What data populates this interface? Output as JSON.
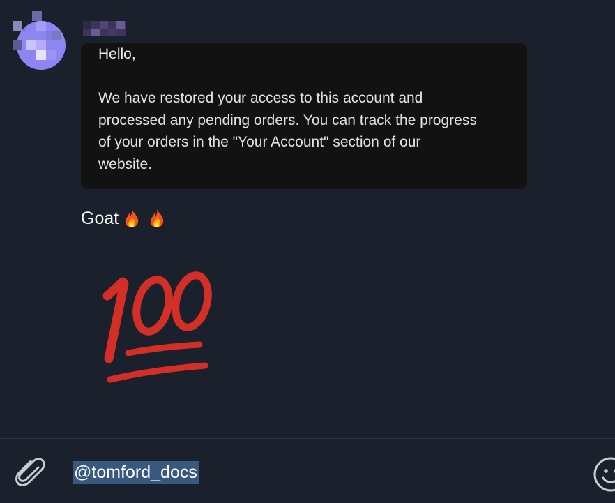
{
  "sender": {
    "avatar_colors": [
      "#8d86f2",
      "#7a7edc",
      "#a59cf7",
      "#6e6aa8",
      "#c9c3fb",
      "#5a5d8f"
    ],
    "name_blur_colors": [
      "#3c3558",
      "#514575",
      "#2e2a45",
      "#6a5a98",
      "#43396a"
    ]
  },
  "quoted_message": {
    "greeting": "Hello,",
    "body": "We have restored your access to this account and\nprocessed any pending orders. You can track the progress\nof your orders in the \"Your Account\" section of our\nwebsite."
  },
  "message": {
    "text": "Goat",
    "emoji": [
      "fire-icon",
      "fire-icon"
    ]
  },
  "sticker": {
    "icon": "hundred-points-icon",
    "color": "#d32f27"
  },
  "composer": {
    "input_value": "@tomford_docs",
    "selection_color": "#38587e",
    "attach_icon": "paperclip-icon",
    "emoji_icon": "smiley-icon"
  },
  "colors": {
    "background": "#1b212c",
    "quote_background": "#121212",
    "text": "#ffffff"
  }
}
